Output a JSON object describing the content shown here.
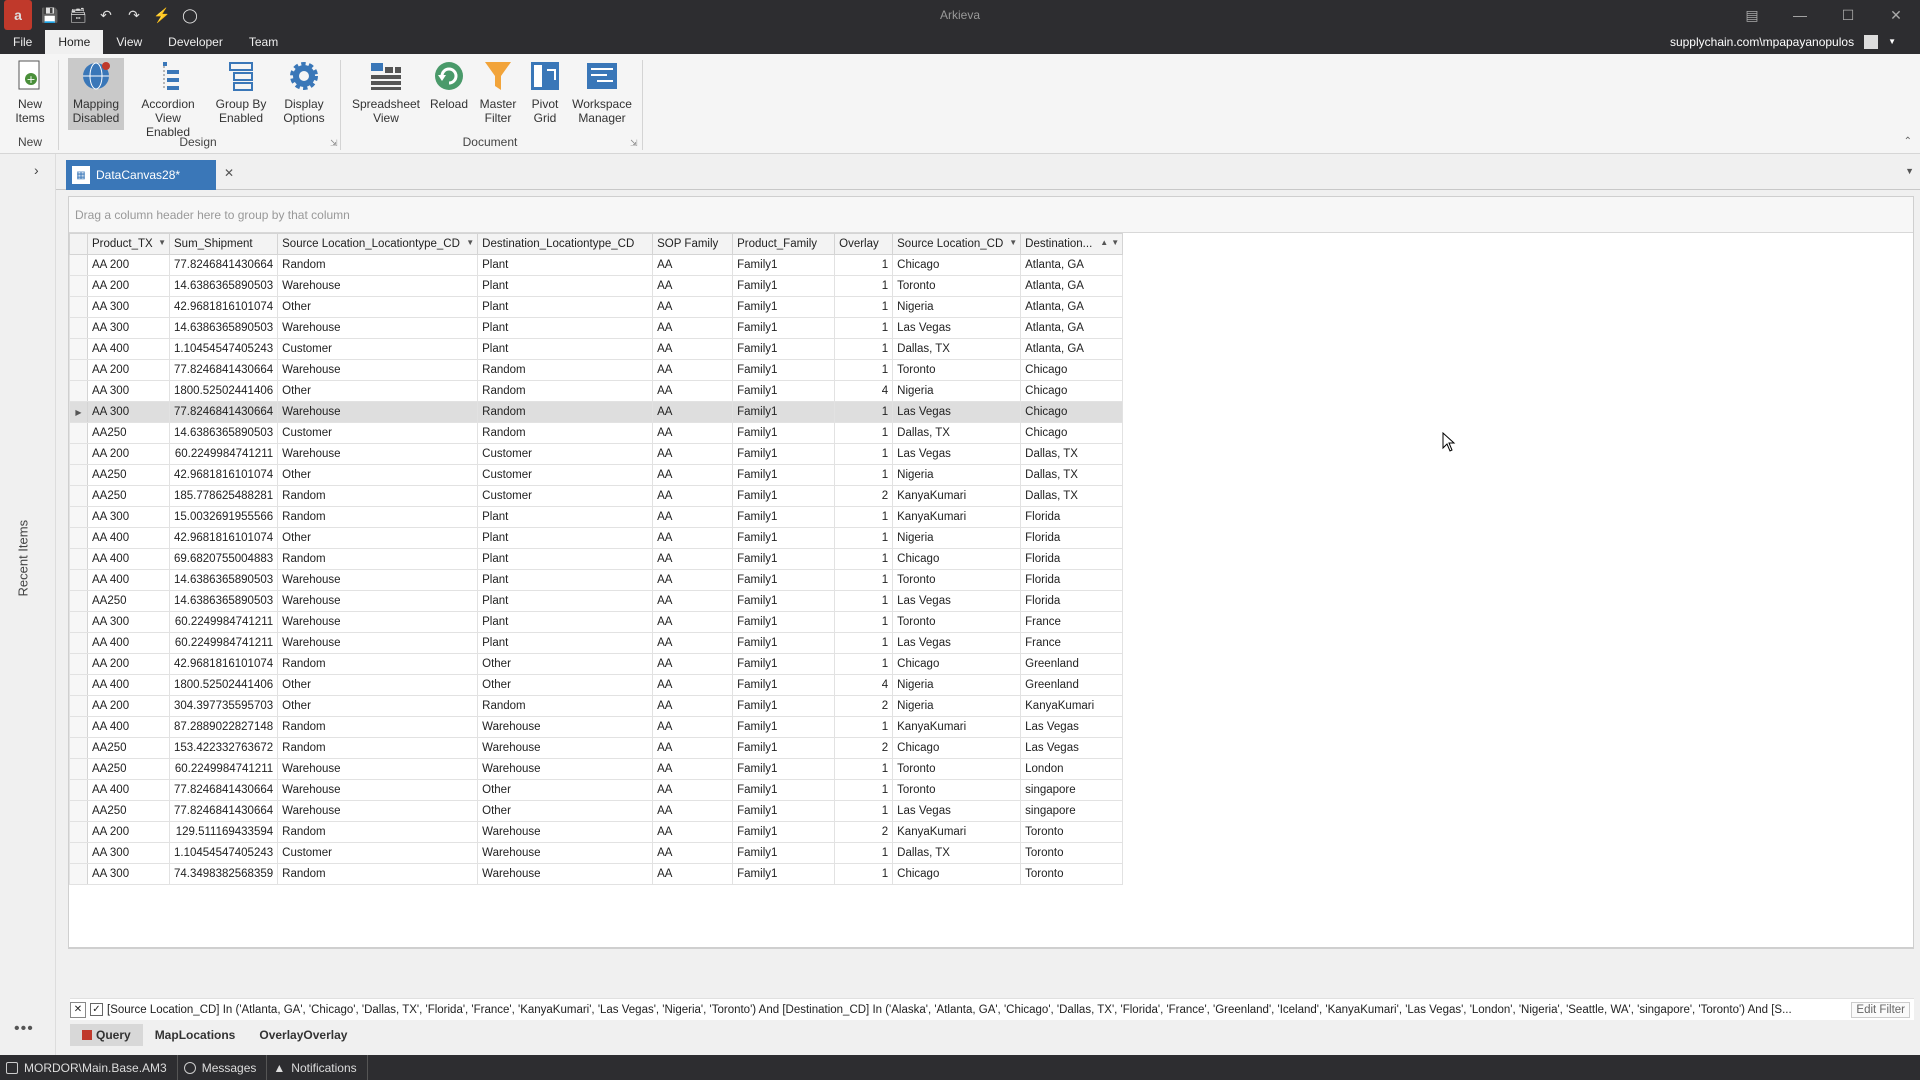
{
  "titlebar": {
    "title": "Arkieva",
    "icons": [
      "app-logo-icon",
      "save-icon",
      "save-all-icon",
      "undo-icon",
      "redo-icon",
      "lightning-icon",
      "lightbulb-icon"
    ]
  },
  "ribbon_tabs": [
    "File",
    "Home",
    "View",
    "Developer",
    "Team"
  ],
  "active_ribbon_tab": "Home",
  "account": "supplychain.com\\mpapayanopulos",
  "ribbon": {
    "new_items": "New Items",
    "mapping_disabled": "Mapping Disabled",
    "accordion_view": "Accordion View Enabled",
    "group_by": "Group By Enabled",
    "display_options": "Display Options",
    "spreadsheet_view": "Spreadsheet View",
    "reload": "Reload",
    "master_filter": "Master Filter",
    "pivot_grid": "Pivot Grid",
    "workspace_manager": "Workspace Manager",
    "group_new": "New",
    "group_design": "Design",
    "group_document": "Document"
  },
  "left_panel": {
    "recent_items": "Recent Items"
  },
  "doc_tab": {
    "label": "DataCanvas28*"
  },
  "grid": {
    "group_hint": "Drag a column header here to group by that column",
    "columns": [
      "Product_TX",
      "Sum_Shipment",
      "Source Location_Locationtype_CD",
      "Destination_Locationtype_CD",
      "SOP Family",
      "Product_Family",
      "Overlay",
      "Source Location_CD",
      "Destination..."
    ],
    "focused_row": 7,
    "rows": [
      [
        "AA 200",
        "77.8246841430664",
        "Random",
        "Plant",
        "AA",
        "Family1",
        "1",
        "Chicago",
        "Atlanta, GA"
      ],
      [
        "AA 200",
        "14.6386365890503",
        "Warehouse",
        "Plant",
        "AA",
        "Family1",
        "1",
        "Toronto",
        "Atlanta, GA"
      ],
      [
        "AA 300",
        "42.9681816101074",
        "Other",
        "Plant",
        "AA",
        "Family1",
        "1",
        "Nigeria",
        "Atlanta, GA"
      ],
      [
        "AA 300",
        "14.6386365890503",
        "Warehouse",
        "Plant",
        "AA",
        "Family1",
        "1",
        "Las Vegas",
        "Atlanta, GA"
      ],
      [
        "AA 400",
        "1.10454547405243",
        "Customer",
        "Plant",
        "AA",
        "Family1",
        "1",
        "Dallas, TX",
        "Atlanta, GA"
      ],
      [
        "AA 200",
        "77.8246841430664",
        "Warehouse",
        "Random",
        "AA",
        "Family1",
        "1",
        "Toronto",
        "Chicago"
      ],
      [
        "AA 300",
        "1800.52502441406",
        "Other",
        "Random",
        "AA",
        "Family1",
        "4",
        "Nigeria",
        "Chicago"
      ],
      [
        "AA 300",
        "77.8246841430664",
        "Warehouse",
        "Random",
        "AA",
        "Family1",
        "1",
        "Las Vegas",
        "Chicago"
      ],
      [
        "AA250",
        "14.6386365890503",
        "Customer",
        "Random",
        "AA",
        "Family1",
        "1",
        "Dallas, TX",
        "Chicago"
      ],
      [
        "AA 200",
        "60.2249984741211",
        "Warehouse",
        "Customer",
        "AA",
        "Family1",
        "1",
        "Las Vegas",
        "Dallas, TX"
      ],
      [
        "AA250",
        "42.9681816101074",
        "Other",
        "Customer",
        "AA",
        "Family1",
        "1",
        "Nigeria",
        "Dallas, TX"
      ],
      [
        "AA250",
        "185.778625488281",
        "Random",
        "Customer",
        "AA",
        "Family1",
        "2",
        "KanyaKumari",
        "Dallas, TX"
      ],
      [
        "AA 300",
        "15.0032691955566",
        "Random",
        "Plant",
        "AA",
        "Family1",
        "1",
        "KanyaKumari",
        "Florida"
      ],
      [
        "AA 400",
        "42.9681816101074",
        "Other",
        "Plant",
        "AA",
        "Family1",
        "1",
        "Nigeria",
        "Florida"
      ],
      [
        "AA 400",
        "69.6820755004883",
        "Random",
        "Plant",
        "AA",
        "Family1",
        "1",
        "Chicago",
        "Florida"
      ],
      [
        "AA 400",
        "14.6386365890503",
        "Warehouse",
        "Plant",
        "AA",
        "Family1",
        "1",
        "Toronto",
        "Florida"
      ],
      [
        "AA250",
        "14.6386365890503",
        "Warehouse",
        "Plant",
        "AA",
        "Family1",
        "1",
        "Las Vegas",
        "Florida"
      ],
      [
        "AA 300",
        "60.2249984741211",
        "Warehouse",
        "Plant",
        "AA",
        "Family1",
        "1",
        "Toronto",
        "France"
      ],
      [
        "AA 400",
        "60.2249984741211",
        "Warehouse",
        "Plant",
        "AA",
        "Family1",
        "1",
        "Las Vegas",
        "France"
      ],
      [
        "AA 200",
        "42.9681816101074",
        "Random",
        "Other",
        "AA",
        "Family1",
        "1",
        "Chicago",
        "Greenland"
      ],
      [
        "AA 400",
        "1800.52502441406",
        "Other",
        "Other",
        "AA",
        "Family1",
        "4",
        "Nigeria",
        "Greenland"
      ],
      [
        "AA 200",
        "304.397735595703",
        "Other",
        "Random",
        "AA",
        "Family1",
        "2",
        "Nigeria",
        "KanyaKumari"
      ],
      [
        "AA 400",
        "87.2889022827148",
        "Random",
        "Warehouse",
        "AA",
        "Family1",
        "1",
        "KanyaKumari",
        "Las Vegas"
      ],
      [
        "AA250",
        "153.422332763672",
        "Random",
        "Warehouse",
        "AA",
        "Family1",
        "2",
        "Chicago",
        "Las Vegas"
      ],
      [
        "AA250",
        "60.2249984741211",
        "Warehouse",
        "Warehouse",
        "AA",
        "Family1",
        "1",
        "Toronto",
        "London"
      ],
      [
        "AA 400",
        "77.8246841430664",
        "Warehouse",
        "Other",
        "AA",
        "Family1",
        "1",
        "Toronto",
        "singapore"
      ],
      [
        "AA250",
        "77.8246841430664",
        "Warehouse",
        "Other",
        "AA",
        "Family1",
        "1",
        "Las Vegas",
        "singapore"
      ],
      [
        "AA 200",
        "129.511169433594",
        "Random",
        "Warehouse",
        "AA",
        "Family1",
        "2",
        "KanyaKumari",
        "Toronto"
      ],
      [
        "AA 300",
        "1.10454547405243",
        "Customer",
        "Warehouse",
        "AA",
        "Family1",
        "1",
        "Dallas, TX",
        "Toronto"
      ],
      [
        "AA 300",
        "74.3498382568359",
        "Random",
        "Warehouse",
        "AA",
        "Family1",
        "1",
        "Chicago",
        "Toronto"
      ]
    ]
  },
  "filter": {
    "text": "[Source Location_CD] In ('Atlanta, GA', 'Chicago', 'Dallas, TX', 'Florida', 'France', 'KanyaKumari', 'Las Vegas', 'Nigeria', 'Toronto') And [Destination_CD] In ('Alaska', 'Atlanta, GA', 'Chicago', 'Dallas, TX', 'Florida', 'France', 'Greenland', 'Iceland', 'KanyaKumari', 'Las Vegas', 'London', 'Nigeria', 'Seattle, WA', 'singapore', 'Toronto') And [S...",
    "edit_label": "Edit Filter"
  },
  "bottom_tabs": [
    "Query",
    "MapLocations",
    "OverlayOverlay"
  ],
  "statusbar": {
    "db": "MORDOR\\Main.Base.AM3",
    "messages": "Messages",
    "notifications": "Notifications"
  },
  "colors": {
    "accent": "#3a77b8",
    "chrome": "#2d2d30",
    "focus_row": "#dedede"
  }
}
